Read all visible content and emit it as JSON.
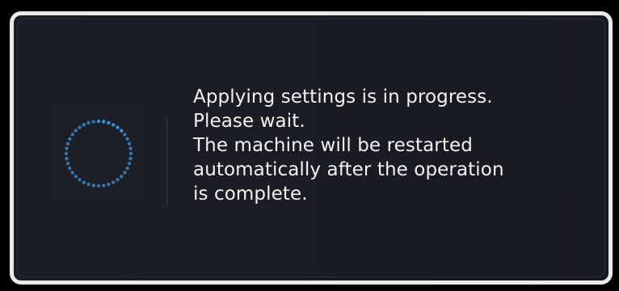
{
  "dialog": {
    "message_lines": [
      "Applying settings is in progress.",
      "Please wait.",
      "The machine will be restarted",
      "automatically after the operation",
      "is complete."
    ]
  },
  "spinner": {
    "icon": "loading-spinner-icon",
    "color": "#3a8fd6"
  },
  "colors": {
    "dialog_background": "#1a1d24",
    "dialog_border": "#e9ecef",
    "text": "#f2f2f2"
  }
}
